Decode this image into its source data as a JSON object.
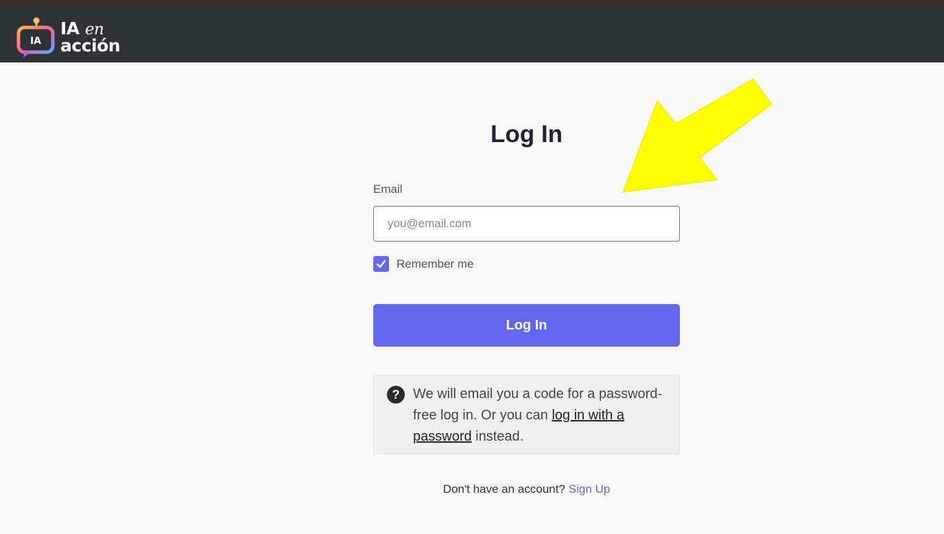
{
  "header": {
    "logo_badge": "IA",
    "logo_line1_main": "IA",
    "logo_line1_accent": "en",
    "logo_line2": "acción"
  },
  "form": {
    "title": "Log In",
    "email_label": "Email",
    "email_placeholder": "you@email.com",
    "email_value": "",
    "remember_label": "Remember me",
    "remember_checked": true,
    "submit_label": "Log In"
  },
  "info": {
    "icon": "question-circle-icon",
    "text_before": "We will email you a code for a password-free log in. Or you can ",
    "link_text": "log in with a password",
    "text_after": " instead."
  },
  "footer": {
    "prompt": "Don't have an account?",
    "signup_label": "Sign Up"
  },
  "colors": {
    "accent": "#6366f1",
    "topbar": "#2e3436",
    "annotation_arrow": "#ffff00"
  }
}
